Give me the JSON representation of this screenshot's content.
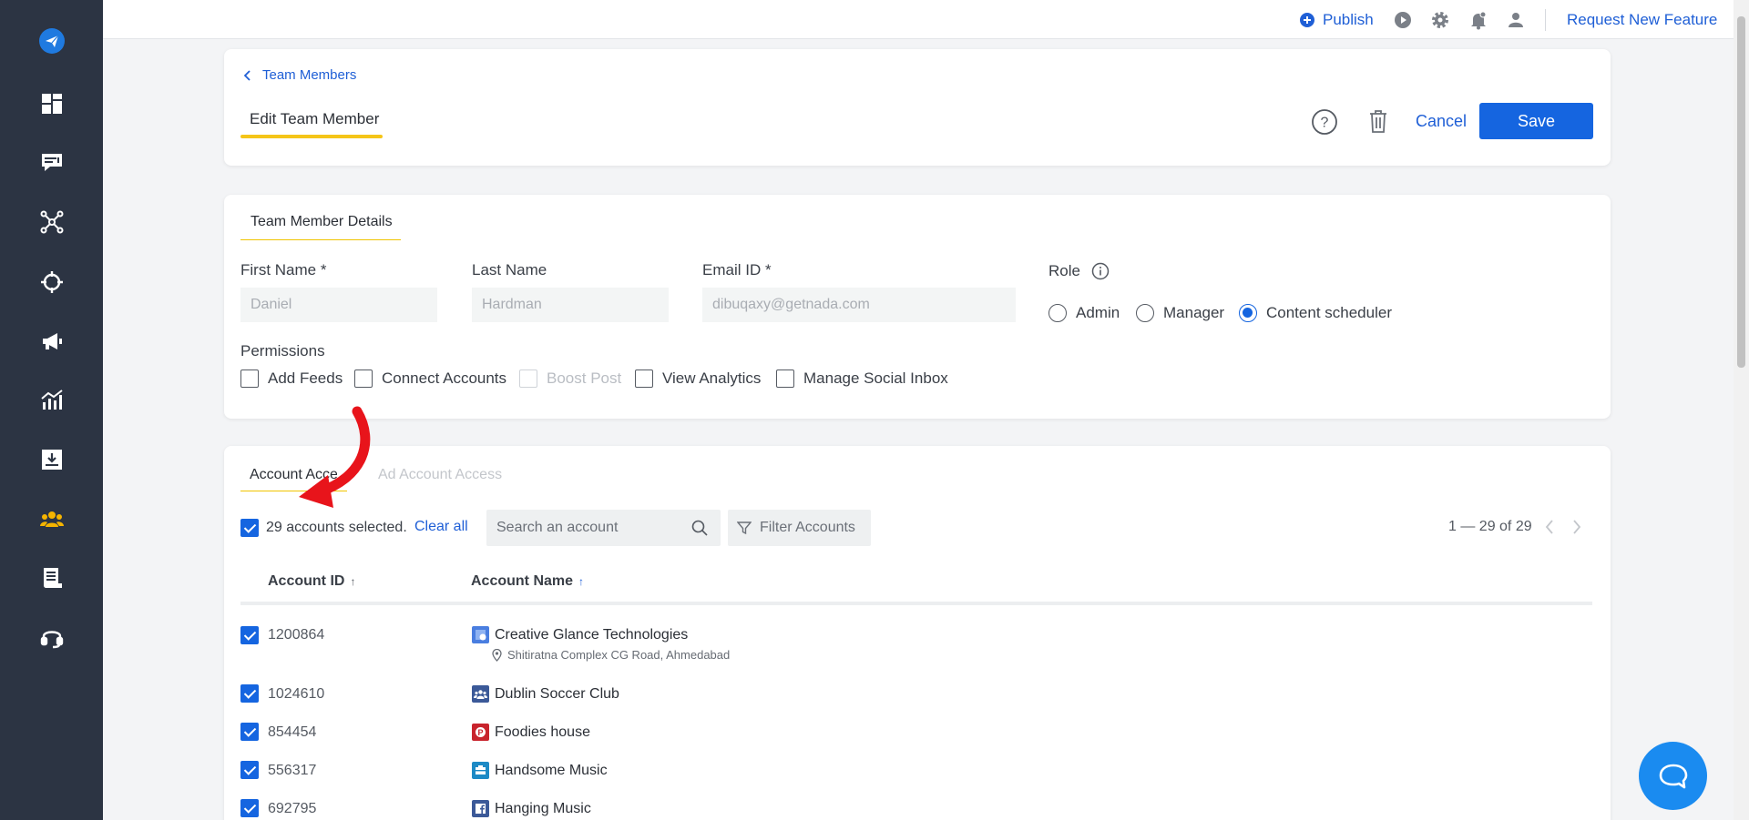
{
  "sidebar": {
    "items": [
      {
        "icon": "send-logo-icon"
      },
      {
        "icon": "dashboard-icon"
      },
      {
        "icon": "inbox-messages-icon"
      },
      {
        "icon": "network-icon"
      },
      {
        "icon": "target-icon"
      },
      {
        "icon": "megaphone-icon"
      },
      {
        "icon": "analytics-icon"
      },
      {
        "icon": "download-icon"
      },
      {
        "icon": "team-icon"
      },
      {
        "icon": "reports-icon"
      },
      {
        "icon": "support-headset-icon"
      }
    ],
    "colors": {
      "background": "#2c3443",
      "active": "#f5b400",
      "logo": "#1f7ae0"
    }
  },
  "topbar": {
    "publish_label": "Publish",
    "request_label": "Request New Feature"
  },
  "header": {
    "breadcrumb": "Team Members",
    "tab_label": "Edit Team Member",
    "cancel_label": "Cancel",
    "save_label": "Save"
  },
  "details": {
    "tab_label": "Team Member Details",
    "first_name_label": "First Name *",
    "first_name_value": "Daniel",
    "last_name_label": "Last Name",
    "last_name_value": "Hardman",
    "email_label": "Email ID *",
    "email_value": "dibuqaxy@getnada.com",
    "role_label": "Role",
    "roles": [
      {
        "label": "Admin",
        "selected": false
      },
      {
        "label": "Manager",
        "selected": false
      },
      {
        "label": "Content scheduler",
        "selected": true
      }
    ],
    "permissions_label": "Permissions",
    "permissions": [
      {
        "label": "Add Feeds",
        "checked": false,
        "disabled": false
      },
      {
        "label": "Connect Accounts",
        "checked": false,
        "disabled": false
      },
      {
        "label": "Boost Post",
        "checked": false,
        "disabled": true
      },
      {
        "label": "View Analytics",
        "checked": false,
        "disabled": false
      },
      {
        "label": "Manage Social Inbox",
        "checked": false,
        "disabled": false
      }
    ]
  },
  "accounts": {
    "tab_account_access": "Account Access",
    "tab_ad_access": "Ad Account Access",
    "selected_text": "29 accounts selected.",
    "clear_all": "Clear all",
    "search_placeholder": "Search an account",
    "filter_label": "Filter Accounts",
    "pagination": "1 — 29 of 29",
    "col_id": "Account ID",
    "col_name": "Account Name",
    "rows": [
      {
        "id": "1200864",
        "name": "Creative Glance Technologies",
        "address": "Shitiratna Complex CG Road, Ahmedabad",
        "icon": "google-business-icon",
        "icon_color": "#4a7ee0"
      },
      {
        "id": "1024610",
        "name": "Dublin Soccer Club",
        "icon": "facebook-group-icon",
        "icon_color": "#3b5998"
      },
      {
        "id": "854454",
        "name": "Foodies house",
        "icon": "pinterest-icon",
        "icon_color": "#c8232c"
      },
      {
        "id": "556317",
        "name": "Handsome Music",
        "icon": "instagram-business-icon",
        "icon_color": "#1d8ac5"
      },
      {
        "id": "692795",
        "name": "Hanging Music",
        "icon": "facebook-icon",
        "icon_color": "#3b5998"
      }
    ]
  },
  "colors": {
    "primary": "#1565e0",
    "accent_yellow": "#f5c518",
    "annotation_arrow": "#e8141b"
  }
}
